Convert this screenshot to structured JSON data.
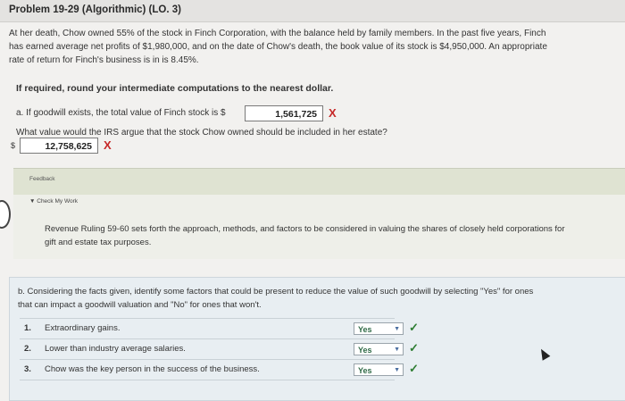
{
  "problem": {
    "title": "Problem 19-29 (Algorithmic) (LO. 3)"
  },
  "intro": {
    "line1": "At her death, Chow owned 55% of the stock in Finch Corporation, with the balance held by family members. In the past five years, Finch",
    "line2": "has earned average net profits of $1,980,000, and on the date of Chow's death, the book value of its stock is $4,950,000. An appropriate",
    "line3": "rate of return for Finch's business is in is 8.45%."
  },
  "instruction": "If required, round your intermediate computations to the nearest dollar.",
  "part_a": {
    "prompt": "a. If goodwill exists, the total value of Finch stock is $",
    "answer": "1,561,725",
    "answer_mark": "X",
    "question2": "What value would the IRS argue that the stock Chow owned should be included in her estate?",
    "currency": "$",
    "answer2": "12,758,625",
    "answer2_mark": "X"
  },
  "feedback": {
    "label": "Feedback",
    "check_label": "Check My Work",
    "line1": "Revenue Ruling 59-60 sets forth the approach, methods, and factors to be considered in valuing the shares of closely held corporations for",
    "line2": "gift and estate tax purposes."
  },
  "part_b": {
    "line1": "b. Considering the facts given, identify some factors that could be present to reduce the value of such goodwill by selecting \"Yes\" for ones",
    "line2": "that can impact a goodwill valuation and \"No\" for ones that won't.",
    "rows": [
      {
        "num": "1.",
        "label": "Extraordinary gains.",
        "value": "Yes",
        "mark": "✓"
      },
      {
        "num": "2.",
        "label": "Lower than industry average salaries.",
        "value": "Yes",
        "mark": "✓"
      },
      {
        "num": "3.",
        "label": "Chow was the key person in the success of the business.",
        "value": "Yes",
        "mark": "✓"
      }
    ]
  },
  "colors": {
    "error": "#c62828",
    "correct": "#2e7d32",
    "feedback_bg": "#dfe3d2"
  }
}
